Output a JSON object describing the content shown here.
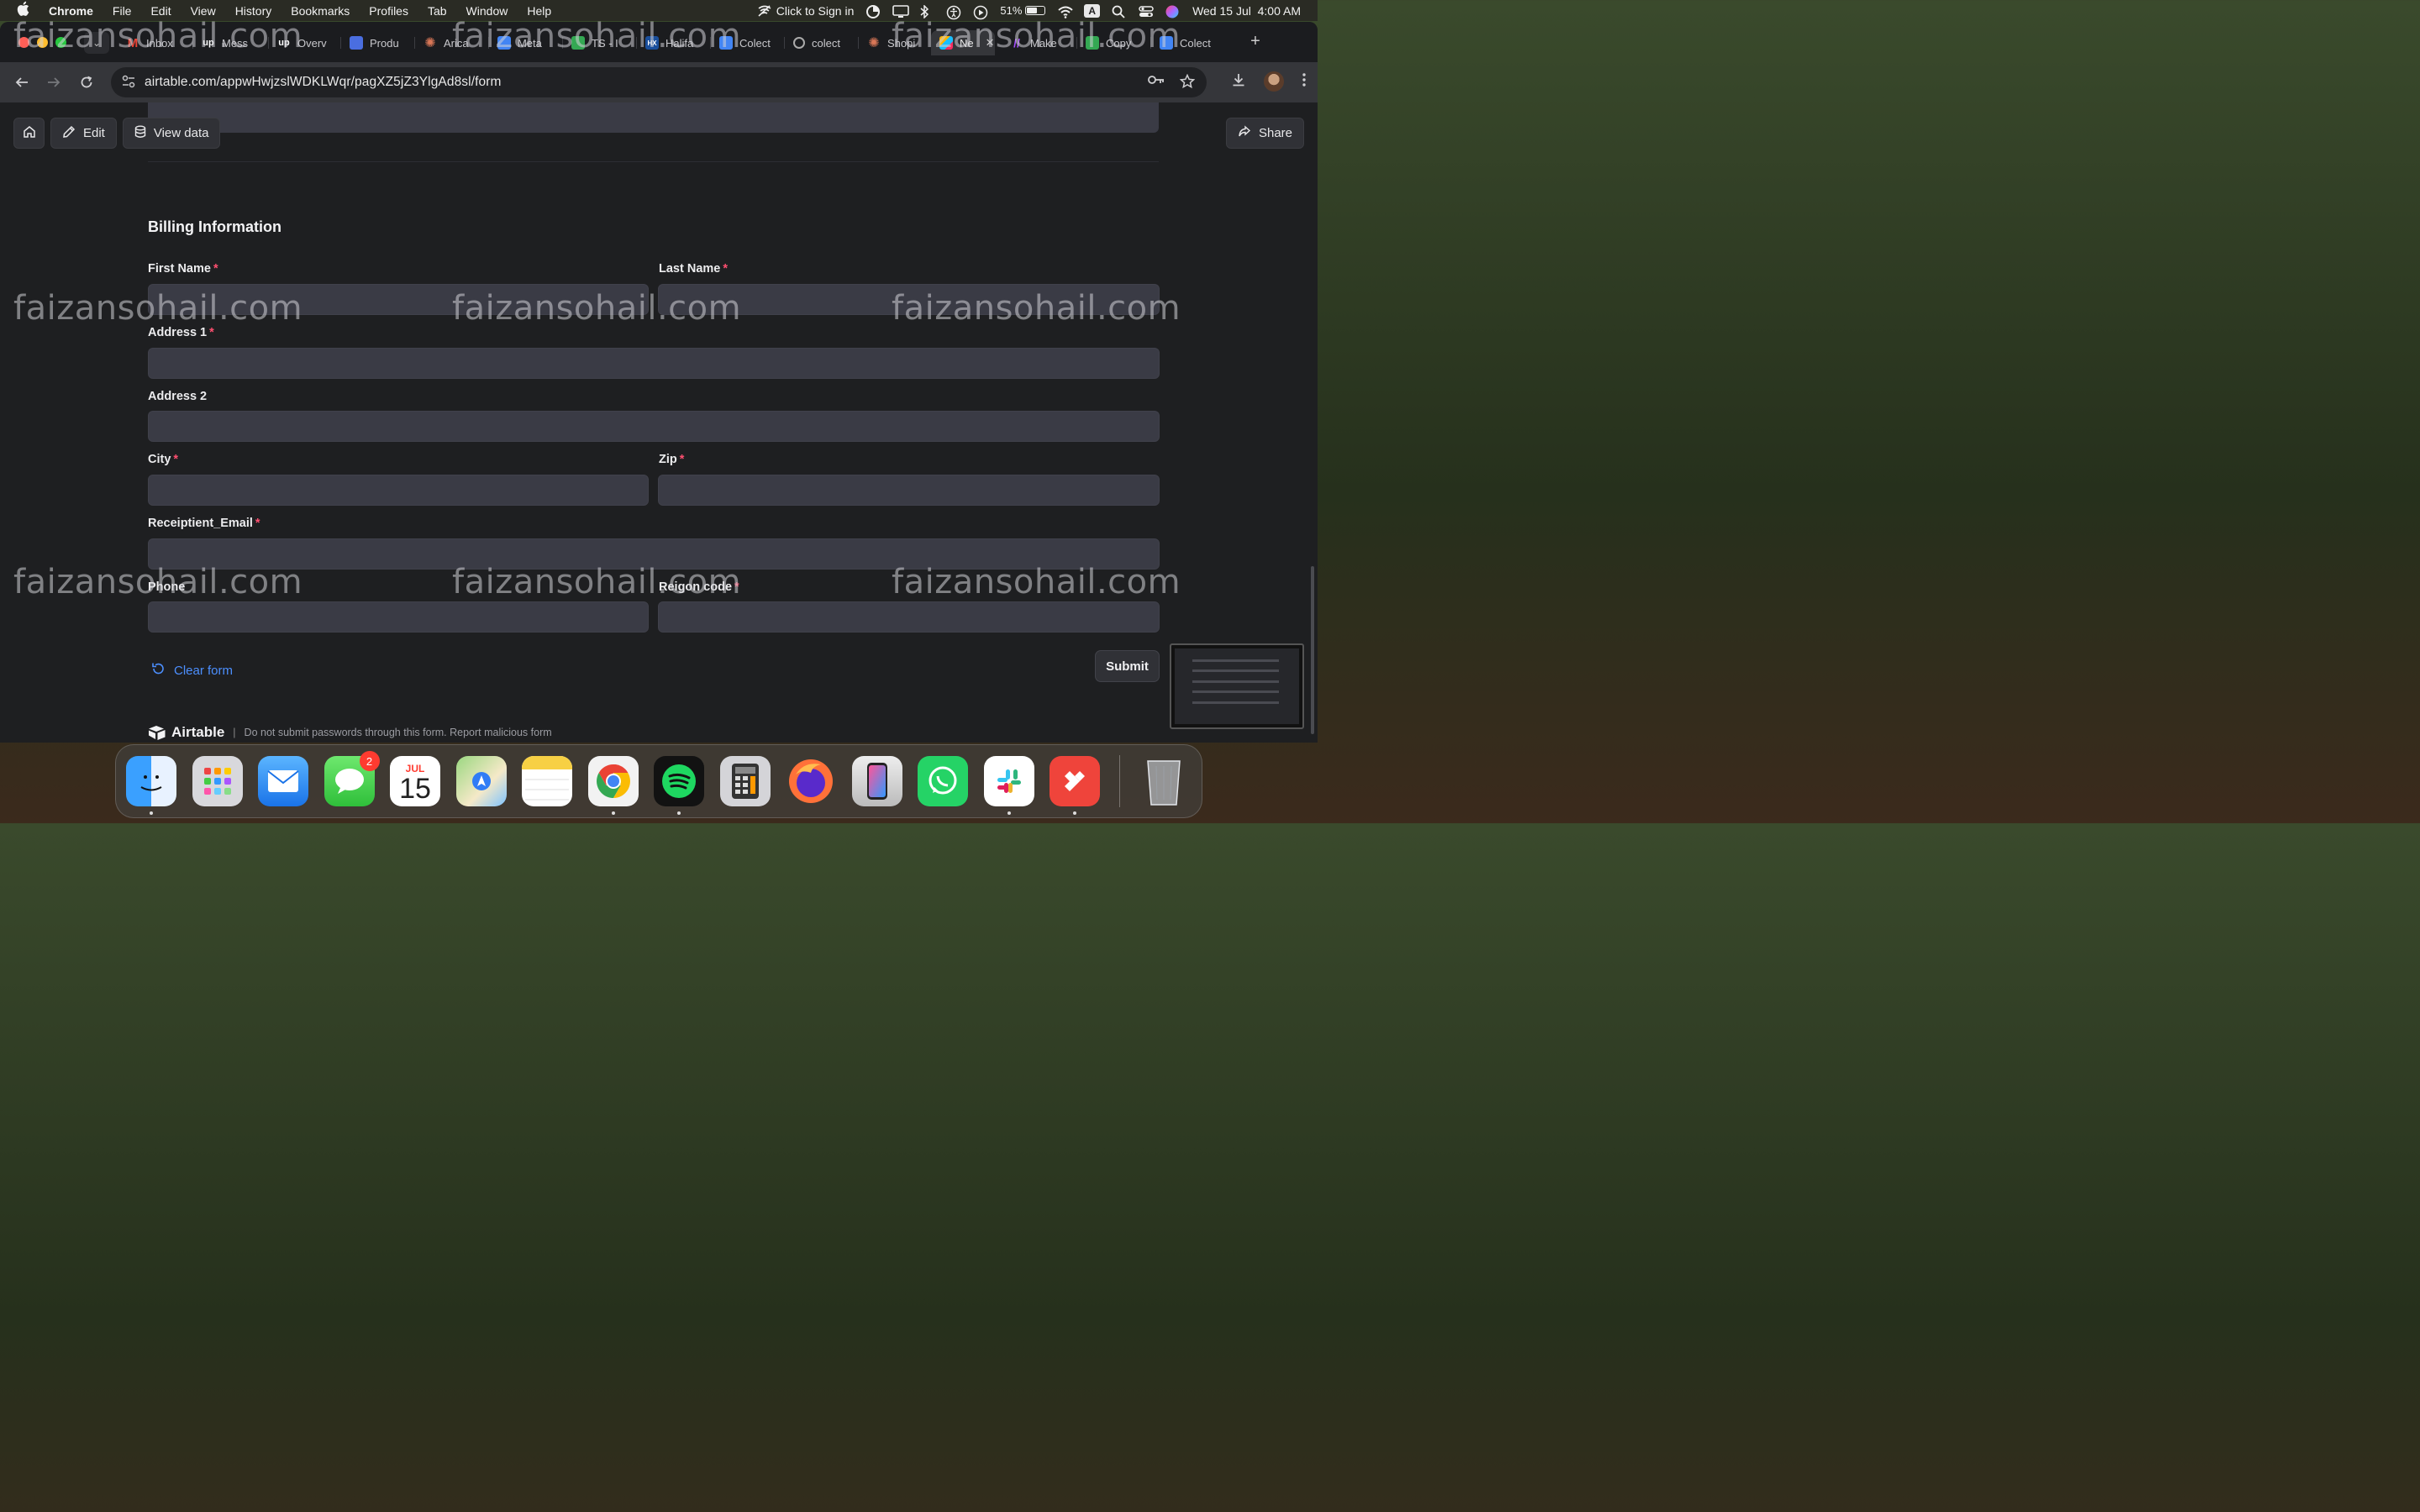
{
  "menubar": {
    "app": "Chrome",
    "items": [
      "File",
      "Edit",
      "View",
      "History",
      "Bookmarks",
      "Profiles",
      "Tab",
      "Window",
      "Help"
    ],
    "sign_in": "Click to Sign in",
    "battery": "51%",
    "battery_level": 0.51,
    "input_source": "A",
    "datetime": "Wed 15 Jul  4:00 AM"
  },
  "tabs": [
    {
      "label": "Inbox",
      "icon": "gmail-icon",
      "color": "#ea4335"
    },
    {
      "label": "Mess",
      "icon": "upwork-icon",
      "color": "#1b1c1f"
    },
    {
      "label": "Overv",
      "icon": "upwork-icon",
      "color": "#1b1c1f"
    },
    {
      "label": "Produ",
      "icon": "box-icon",
      "color": "#4a6ee0"
    },
    {
      "label": "Arica",
      "icon": "claude-icon",
      "color": "#d97757"
    },
    {
      "label": "Meta",
      "icon": "doc-icon",
      "color": "#4285f4"
    },
    {
      "label": "TS - I",
      "icon": "sheet-icon",
      "color": "#34a853"
    },
    {
      "label": "Halifa",
      "icon": "halifax-icon",
      "color": "#1a4f9c"
    },
    {
      "label": "Colect",
      "icon": "doc-icon",
      "color": "#4285f4"
    },
    {
      "label": "colect",
      "icon": "globe-icon",
      "color": "#555"
    },
    {
      "label": "Shopi",
      "icon": "claude-icon",
      "color": "#d97757"
    },
    {
      "label": "Ne",
      "icon": "airtable-icon",
      "color": "#fcb400",
      "active": true
    },
    {
      "label": "Make",
      "icon": "make-icon",
      "color": "#6d00cc"
    },
    {
      "label": "Copy",
      "icon": "sheet-icon",
      "color": "#34a853"
    },
    {
      "label": "Colect",
      "icon": "doc-icon",
      "color": "#4285f4"
    }
  ],
  "address_bar": {
    "url": "airtable.com/appwHwjzslWDKLWqr/pagXZ5jZ3YlgAd8sl/form"
  },
  "page_buttons": {
    "edit": "Edit",
    "view_data": "View data",
    "share": "Share"
  },
  "form": {
    "section_title": "Billing Information",
    "fields": {
      "first_name": {
        "label": "First Name",
        "required": "*"
      },
      "last_name": {
        "label": "Last Name",
        "required": "*"
      },
      "address1": {
        "label": "Address 1",
        "required": "*"
      },
      "address2": {
        "label": "Address 2"
      },
      "city": {
        "label": "City",
        "required": "*"
      },
      "zip": {
        "label": "Zip",
        "required": "*"
      },
      "email": {
        "label": "Receiptient_Email",
        "required": "*"
      },
      "phone": {
        "label": "Phone"
      },
      "region": {
        "label": "Reigon code",
        "required": "*"
      }
    },
    "clear_form": "Clear form",
    "submit": "Submit"
  },
  "footer": {
    "brand": "Airtable",
    "separator": "|",
    "notice": "Do not submit passwords through this form. Report malicious form"
  },
  "watermark": "faizansohail.com",
  "dock": {
    "apps": [
      "Finder",
      "Launchpad",
      "Mail",
      "Messages",
      "Calendar",
      "Maps",
      "Notes",
      "Chrome",
      "Spotify",
      "Calculator",
      "Firefox",
      "iPhone Mirroring",
      "WhatsApp",
      "Slack",
      "AnyDesk",
      "Trash"
    ],
    "messages_badge": "2",
    "calendar_month": "JUL",
    "calendar_day": "15"
  }
}
